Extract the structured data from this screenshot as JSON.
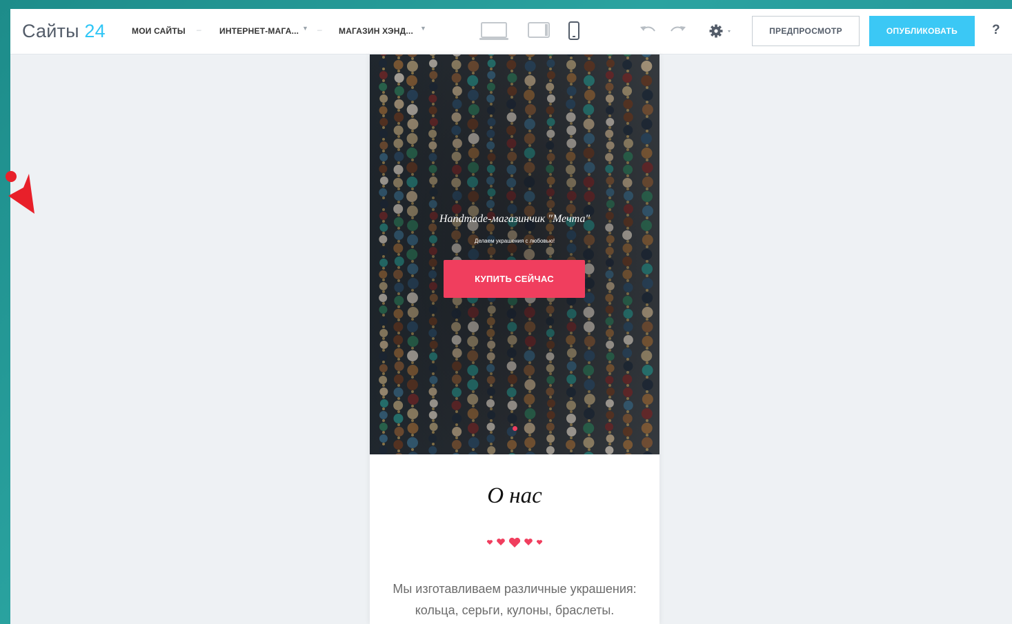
{
  "app": {
    "logo_text": "Сайты",
    "logo_num": "24",
    "brand_color": "#2fc6f6"
  },
  "breadcrumbs": {
    "my_sites": "МОИ САЙТЫ",
    "store": "ИНТЕРНЕТ-МАГА...",
    "page": "МАГАЗИН ХЭНД..."
  },
  "toolbar": {
    "preview_label": "ПРЕДПРОСМОТР",
    "publish_label": "ОПУБЛИКОВАТЬ",
    "help_label": "?",
    "device_icons": [
      "laptop-icon",
      "tablet-icon",
      "phone-icon"
    ],
    "history_icons": [
      "undo-icon",
      "redo-icon"
    ],
    "publish_color": "#3bc8f5"
  },
  "hero": {
    "title": "Handmade-магазинчик \"Мечта\"",
    "subtitle": "Делаем украшения с любовью!",
    "buy_label": "КУПИТЬ СЕЙЧАС",
    "accent_color": "#f03e5e"
  },
  "about": {
    "title": "О нас",
    "text": "Мы изготавливаем различные украшения: кольца, серьги, кулоны, браслеты."
  }
}
